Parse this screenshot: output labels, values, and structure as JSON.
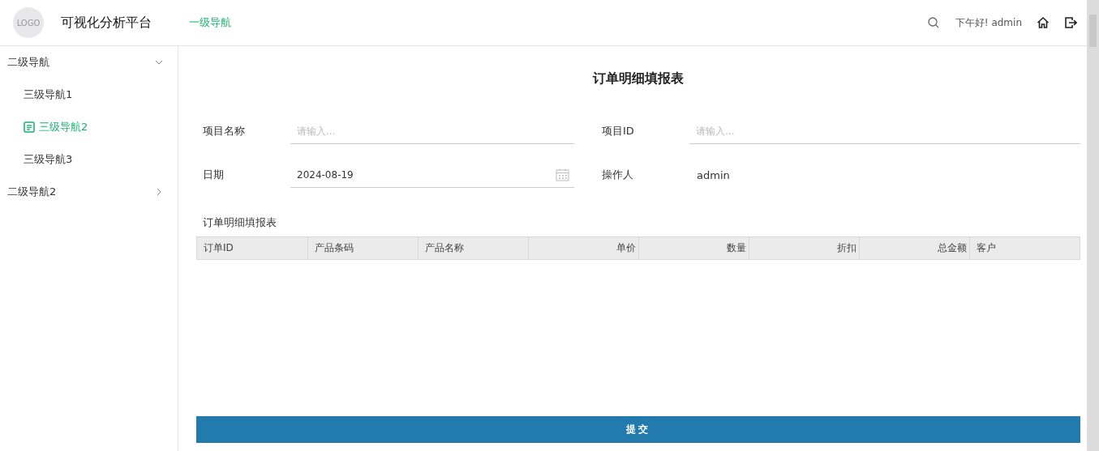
{
  "header": {
    "logo": "LOGO",
    "app_title": "可视化分析平台",
    "nav": [
      {
        "label": "一级导航",
        "selected": true
      }
    ],
    "greeting": "下午好! admin"
  },
  "sidebar": {
    "items": [
      {
        "label": "二级导航",
        "expanded": true,
        "children": [
          {
            "label": "三级导航1",
            "selected": false
          },
          {
            "label": "三级导航2",
            "selected": true
          },
          {
            "label": "三级导航3",
            "selected": false
          }
        ]
      },
      {
        "label": "二级导航2",
        "expanded": false
      }
    ]
  },
  "page_title": "订单明细填报表",
  "form": {
    "fields": [
      {
        "kind": "text",
        "label": "项目名称",
        "placeholder": "请输入..."
      },
      {
        "kind": "text",
        "label": "项目ID",
        "placeholder": "请输入..."
      },
      {
        "kind": "date",
        "label": "日期",
        "value": "2024-08-19"
      },
      {
        "kind": "static",
        "label": "操作人",
        "value": "admin"
      }
    ]
  },
  "table": {
    "caption": "订单明细填报表",
    "columns": [
      {
        "label": "订单ID",
        "kind": "text"
      },
      {
        "label": "产品条码",
        "kind": "text"
      },
      {
        "label": "产品名称",
        "kind": "text"
      },
      {
        "label": "单价",
        "kind": "number"
      },
      {
        "label": "数量",
        "kind": "number"
      },
      {
        "label": "折扣",
        "kind": "number"
      },
      {
        "label": "总金额",
        "kind": "number"
      },
      {
        "label": "客户",
        "kind": "text"
      }
    ]
  },
  "submit_button": "提交"
}
